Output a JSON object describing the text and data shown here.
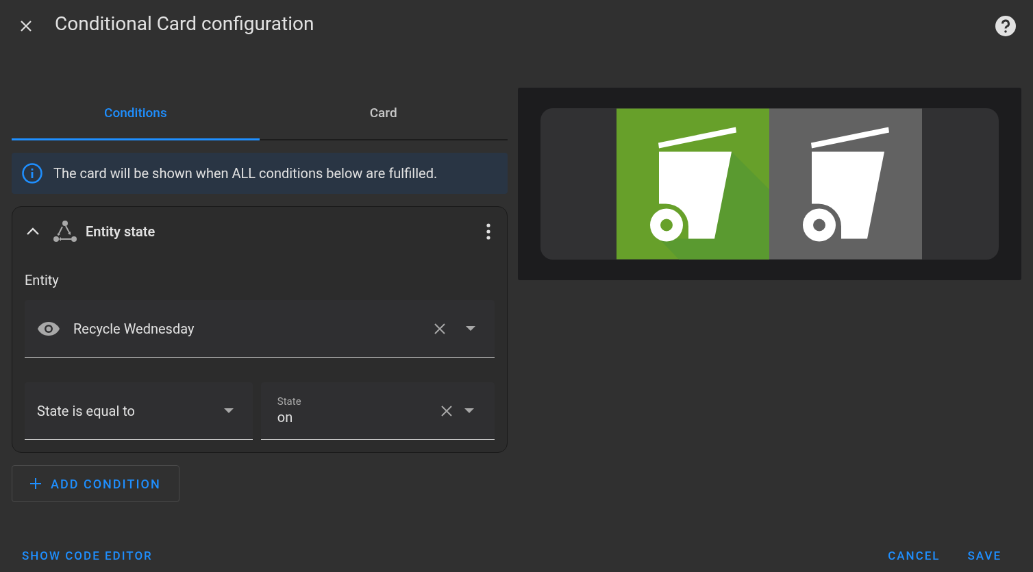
{
  "dialog": {
    "title": "Conditional Card configuration"
  },
  "tabs": [
    {
      "label": "Conditions",
      "selected": true
    },
    {
      "label": "Card",
      "selected": false
    }
  ],
  "info_banner": {
    "text": "The card will be shown when ALL conditions below are fulfilled."
  },
  "conditions": [
    {
      "title": "Entity state",
      "expanded": true,
      "entity_label": "Entity",
      "entity": {
        "value": "Recycle Wednesday"
      },
      "operator": {
        "value": "State is equal to"
      },
      "state": {
        "label": "State",
        "value": "on"
      }
    }
  ],
  "add_condition_button": "ADD CONDITION",
  "preview": {
    "tiles": [
      {
        "kind": "active"
      },
      {
        "kind": "inactive"
      }
    ]
  },
  "footer": {
    "code_editor_button": "SHOW CODE EDITOR",
    "buttons": [
      "CANCEL",
      "SAVE"
    ]
  }
}
